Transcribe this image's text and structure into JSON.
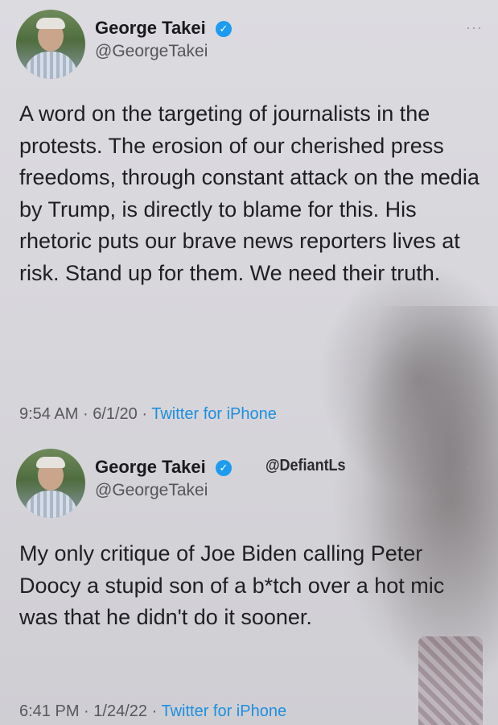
{
  "tweets": [
    {
      "author_name": "George Takei",
      "author_handle": "@GeorgeTakei",
      "verified_icon": "verified-badge-icon",
      "more_icon": "more-options-icon",
      "more_label": "···",
      "text": "A word on the targeting of journalists in the protests. The erosion of our cherished press freedoms, through constant attack on the media by Trump, is directly to blame for this. His rhetoric puts our brave news reporters lives at risk. Stand up for them. We need their truth.",
      "time": "9:54 AM",
      "date": "6/1/20",
      "source": "Twitter for iPhone"
    },
    {
      "author_name": "George Takei",
      "author_handle": "@GeorgeTakei",
      "verified_icon": "verified-badge-icon",
      "more_icon": "more-options-icon",
      "more_label": "···",
      "text": "My only critique of Joe Biden calling Peter Doocy a stupid son of a b*tch over a hot mic was that he didn't do it sooner.",
      "time": "6:41 PM",
      "date": "1/24/22",
      "source": "Twitter for iPhone"
    }
  ],
  "watermark": "@DefiantLs",
  "separator": "·",
  "colors": {
    "verified": "#1d9bf0",
    "source_link": "#1d8fe0",
    "background": "#d8d7dc"
  }
}
